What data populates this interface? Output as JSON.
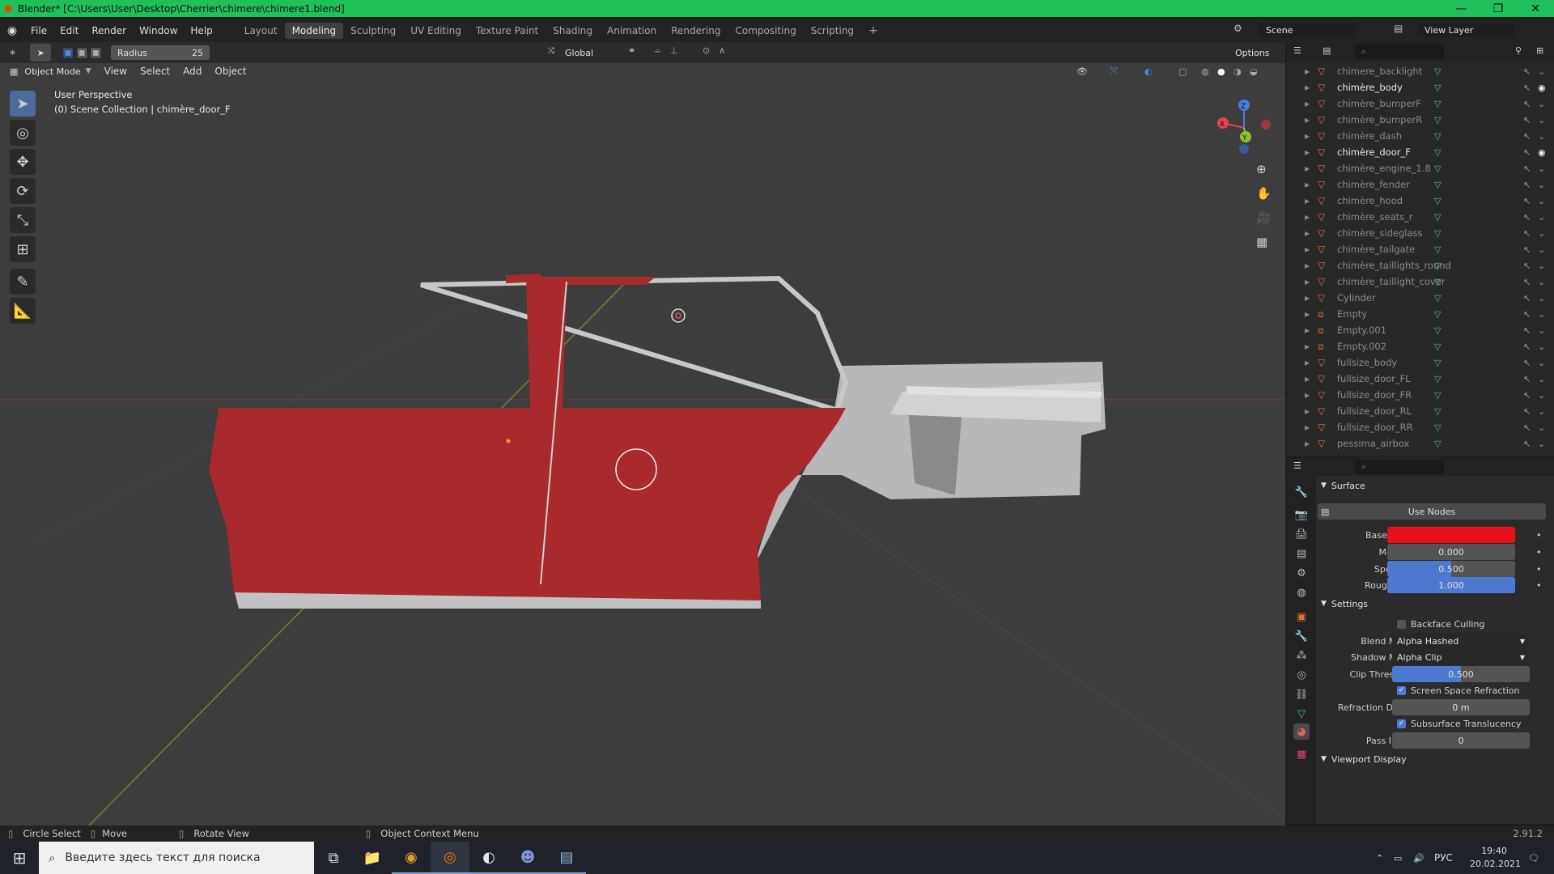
{
  "app": {
    "title": "Blender* [C:\\Users\\User\\Desktop\\Cherrier\\chimere\\chimere1.blend]"
  },
  "menu": [
    "File",
    "Edit",
    "Render",
    "Window",
    "Help"
  ],
  "workspaces": [
    "Layout",
    "Modeling",
    "Sculpting",
    "UV Editing",
    "Texture Paint",
    "Shading",
    "Animation",
    "Rendering",
    "Compositing",
    "Scripting"
  ],
  "active_workspace": "Modeling",
  "scene": {
    "name": "Scene",
    "view_layer": "View Layer"
  },
  "tool_header": {
    "radius_label": "Radius",
    "radius_value": "25",
    "orientation": "Global",
    "options": "Options"
  },
  "mode_header": {
    "mode": "Object Mode",
    "items": [
      "View",
      "Select",
      "Add",
      "Object"
    ]
  },
  "viewport": {
    "perspective": "User Perspective",
    "collection": "(0) Scene Collection | chimère_door_F"
  },
  "gizmo": {
    "x": "X",
    "y": "Y",
    "z": "Z"
  },
  "outliner": {
    "items": [
      {
        "name": "chimere_backlight",
        "highlight": false,
        "type": "mesh"
      },
      {
        "name": "chimère_body",
        "highlight": true,
        "type": "mesh"
      },
      {
        "name": "chimère_bumperF",
        "highlight": false,
        "type": "mesh"
      },
      {
        "name": "chimère_bumperR",
        "highlight": false,
        "type": "mesh"
      },
      {
        "name": "chimère_dash",
        "highlight": false,
        "type": "mesh"
      },
      {
        "name": "chimère_door_F",
        "highlight": true,
        "type": "mesh"
      },
      {
        "name": "chimère_engine_1.8",
        "highlight": false,
        "type": "mesh"
      },
      {
        "name": "chimère_fender",
        "highlight": false,
        "type": "mesh"
      },
      {
        "name": "chimère_hood",
        "highlight": false,
        "type": "mesh"
      },
      {
        "name": "chimère_seats_r",
        "highlight": false,
        "type": "mesh"
      },
      {
        "name": "chimère_sideglass",
        "highlight": false,
        "type": "mesh"
      },
      {
        "name": "chimère_tailgate",
        "highlight": false,
        "type": "mesh"
      },
      {
        "name": "chimère_taillights_round",
        "highlight": false,
        "type": "mesh"
      },
      {
        "name": "chimère_taillight_cover",
        "highlight": false,
        "type": "mesh"
      },
      {
        "name": "Cylinder",
        "highlight": false,
        "type": "mesh"
      },
      {
        "name": "Empty",
        "highlight": false,
        "type": "empty"
      },
      {
        "name": "Empty.001",
        "highlight": false,
        "type": "empty"
      },
      {
        "name": "Empty.002",
        "highlight": false,
        "type": "empty"
      },
      {
        "name": "fullsize_body",
        "highlight": false,
        "type": "mesh"
      },
      {
        "name": "fullsize_door_FL",
        "highlight": false,
        "type": "mesh"
      },
      {
        "name": "fullsize_door_FR",
        "highlight": false,
        "type": "mesh"
      },
      {
        "name": "fullsize_door_RL",
        "highlight": false,
        "type": "mesh"
      },
      {
        "name": "fullsize_door_RR",
        "highlight": false,
        "type": "mesh"
      },
      {
        "name": "pessima_airbox",
        "highlight": false,
        "type": "mesh"
      }
    ]
  },
  "properties": {
    "surface": {
      "title": "Surface",
      "use_nodes": "Use Nodes",
      "base_color_label": "Base Color",
      "base_color": "#e8101a",
      "metallic_label": "Metallic",
      "metallic": "0.000",
      "metallic_fill": 0,
      "specular_label": "Specular",
      "specular": "0.500",
      "specular_fill": 0.5,
      "roughness_label": "Roughness",
      "roughness": "1.000",
      "roughness_fill": 1
    },
    "settings": {
      "title": "Settings",
      "backface_culling": "Backface Culling",
      "backface_checked": false,
      "blend_mode_label": "Blend Mode",
      "blend_mode": "Alpha Hashed",
      "shadow_mode_label": "Shadow Mode",
      "shadow_mode": "Alpha Clip",
      "clip_threshold_label": "Clip Threshold",
      "clip_threshold": "0.500",
      "clip_fill": 0.5,
      "ssr": "Screen Space Refraction",
      "ssr_checked": true,
      "refraction_depth_label": "Refraction Depth",
      "refraction_depth": "0 m",
      "subsurface": "Subsurface Translucency",
      "subsurface_checked": true,
      "pass_index_label": "Pass Index",
      "pass_index": "0"
    },
    "viewport_display": "Viewport Display"
  },
  "statusbar": {
    "circle_select": "Circle Select",
    "move": "Move",
    "rotate": "Rotate View",
    "context": "Object Context Menu",
    "version": "2.91.2"
  },
  "taskbar": {
    "search_placeholder": "Введите здесь текст для поиска",
    "lang": "РУС",
    "time": "19:40",
    "date": "20.02.2021"
  },
  "colors": {
    "accent": "#4d7ad0",
    "title_bar": "#20c05a",
    "car_red": "#a82a2c",
    "selected_tab": "#e0702e"
  }
}
